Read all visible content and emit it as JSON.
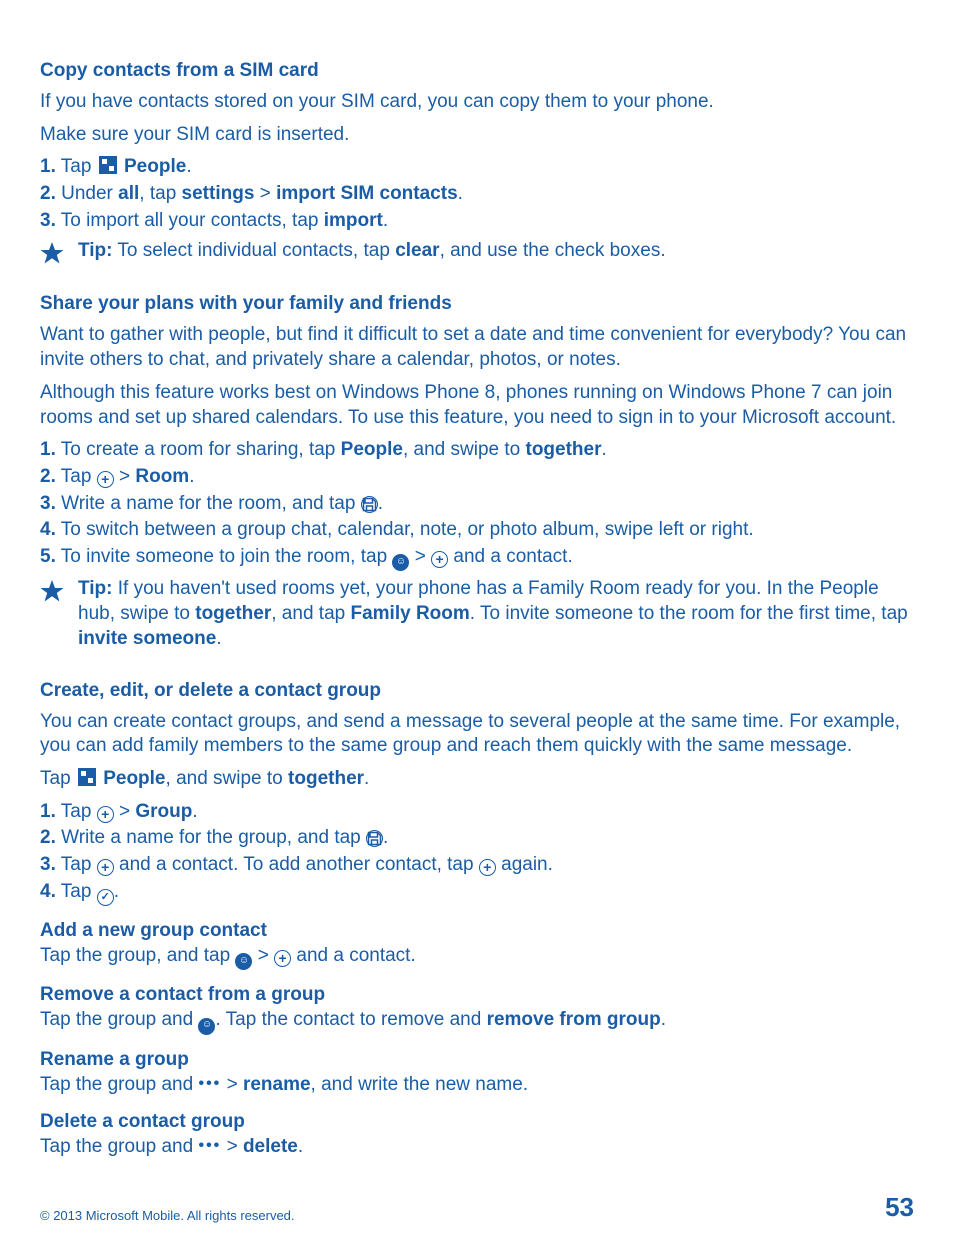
{
  "section1": {
    "heading": "Copy contacts from a SIM card",
    "p1": "If you have contacts stored on your SIM card, you can copy them to your phone.",
    "p2": "Make sure your SIM card is inserted.",
    "steps": {
      "s1_num": "1.",
      "s1_a": " Tap ",
      "s1_b": "People",
      "s1_c": ".",
      "s2_num": "2.",
      "s2_a": " Under ",
      "s2_b": "all",
      "s2_c": ", tap ",
      "s2_d": "settings",
      "s2_e": " > ",
      "s2_f": "import SIM contacts",
      "s2_g": ".",
      "s3_num": "3.",
      "s3_a": " To import all your contacts, tap ",
      "s3_b": "import",
      "s3_c": "."
    },
    "tip": {
      "label": "Tip:",
      "text_a": " To select individual contacts, tap ",
      "text_b": "clear",
      "text_c": ", and use the check boxes."
    }
  },
  "section2": {
    "heading": "Share your plans with your family and friends",
    "p1": "Want to gather with people, but find it difficult to set a date and time convenient for everybody? You can invite others to chat, and privately share a calendar, photos, or notes.",
    "p2": "Although this feature works best on Windows Phone 8, phones running on Windows Phone 7 can join rooms and set up shared calendars. To use this feature, you need to sign in to your Microsoft account.",
    "steps": {
      "s1_num": "1.",
      "s1_a": " To create a room for sharing, tap ",
      "s1_b": "People",
      "s1_c": ", and swipe to ",
      "s1_d": "together",
      "s1_e": ".",
      "s2_num": "2.",
      "s2_a": " Tap ",
      "s2_b": " > ",
      "s2_c": "Room",
      "s2_d": ".",
      "s3_num": "3.",
      "s3_a": " Write a name for the room, and tap ",
      "s3_b": ".",
      "s4_num": "4.",
      "s4_a": " To switch between a group chat, calendar, note, or photo album, swipe left or right.",
      "s5_num": "5.",
      "s5_a": " To invite someone to join the room, tap ",
      "s5_b": " > ",
      "s5_c": " and a contact."
    },
    "tip": {
      "label": "Tip:",
      "a": " If you haven't used rooms yet, your phone has a Family Room ready for you. In the People hub, swipe to ",
      "b": "together",
      "c": ", and tap ",
      "d": "Family Room",
      "e": ". To invite someone to the room for the first time, tap ",
      "f": "invite someone",
      "g": "."
    }
  },
  "section3": {
    "heading": "Create, edit, or delete a contact group",
    "p1": "You can create contact groups, and send a message to several people at the same time. For example, you can add family members to the same group and reach them quickly with the same message.",
    "lead": {
      "a": "Tap ",
      "b": "People",
      "c": ", and swipe to ",
      "d": "together",
      "e": "."
    },
    "steps": {
      "s1_num": "1.",
      "s1_a": " Tap ",
      "s1_b": " > ",
      "s1_c": "Group",
      "s1_d": ".",
      "s2_num": "2.",
      "s2_a": " Write a name for the group, and tap ",
      "s2_b": ".",
      "s3_num": "3.",
      "s3_a": " Tap ",
      "s3_b": " and a contact. To add another contact, tap ",
      "s3_c": " again.",
      "s4_num": "4.",
      "s4_a": " Tap ",
      "s4_b": "."
    },
    "sub_add": {
      "h": "Add a new group contact",
      "a": "Tap the group, and tap ",
      "b": " > ",
      "c": " and a contact."
    },
    "sub_remove": {
      "h": "Remove a contact from a group",
      "a": "Tap the group and ",
      "b": ". Tap the contact to remove and ",
      "c": "remove from group",
      "d": "."
    },
    "sub_rename": {
      "h": "Rename a group",
      "a": "Tap the group and ",
      "b": " > ",
      "c": "rename",
      "d": ", and write the new name."
    },
    "sub_delete": {
      "h": "Delete a contact group",
      "a": "Tap the group and ",
      "b": " > ",
      "c": "delete",
      "d": "."
    }
  },
  "footer": {
    "copyright": "© 2013 Microsoft Mobile. All rights reserved.",
    "page": "53"
  },
  "icons": {
    "more_dots": "•••"
  }
}
